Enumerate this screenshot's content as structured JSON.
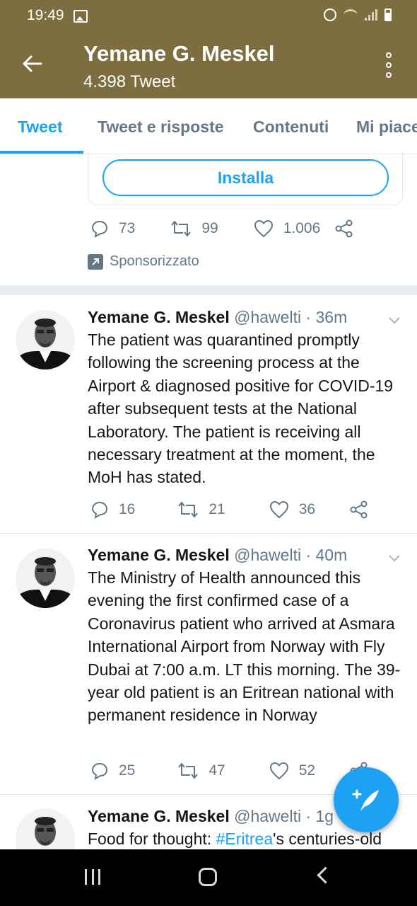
{
  "status_bar": {
    "time": "19:49"
  },
  "header": {
    "title": "Yemane G. Meskel",
    "subtitle": "4.398 Tweet"
  },
  "tabs": [
    {
      "label": "Tweet"
    },
    {
      "label": "Tweet e risposte"
    },
    {
      "label": "Contenuti"
    },
    {
      "label": "Mi piace"
    }
  ],
  "promo": {
    "install_label": "Installa",
    "replies": "73",
    "retweets": "99",
    "likes": "1.006",
    "sponsored_label": "Sponsorizzato"
  },
  "tweets": [
    {
      "name": "Yemane G. Meskel",
      "handle_time": "@hawelti · 36m",
      "text": "The patient was quarantined promptly following the screening process at the Airport & diagnosed positive for COVID-19 after subsequent tests at the National Laboratory. The patient is receiving all necessary treatment at the moment, the MoH has stated.",
      "replies": "16",
      "retweets": "21",
      "likes": "36"
    },
    {
      "name": "Yemane G. Meskel",
      "handle_time": "@hawelti · 40m",
      "text": "The Ministry of Health announced this evening the first confirmed case of a Coronavirus patient who arrived at Asmara International Airport from Norway with Fly Dubai at 7:00 a.m. LT this morning.  The 39-year old patient is an Eritrean national with permanent residence in Norway",
      "replies": "25",
      "retweets": "47",
      "likes": "52"
    },
    {
      "name": "Yemane G. Meskel",
      "handle_time": "@hawelti · 1g",
      "text_before": "Food for thought: ",
      "hashtag": "#Eritrea",
      "text_after": "'s centuries-old"
    }
  ],
  "colors": {
    "header_bg": "#7d6e3f",
    "accent": "#1da1f2",
    "muted": "#657786"
  }
}
